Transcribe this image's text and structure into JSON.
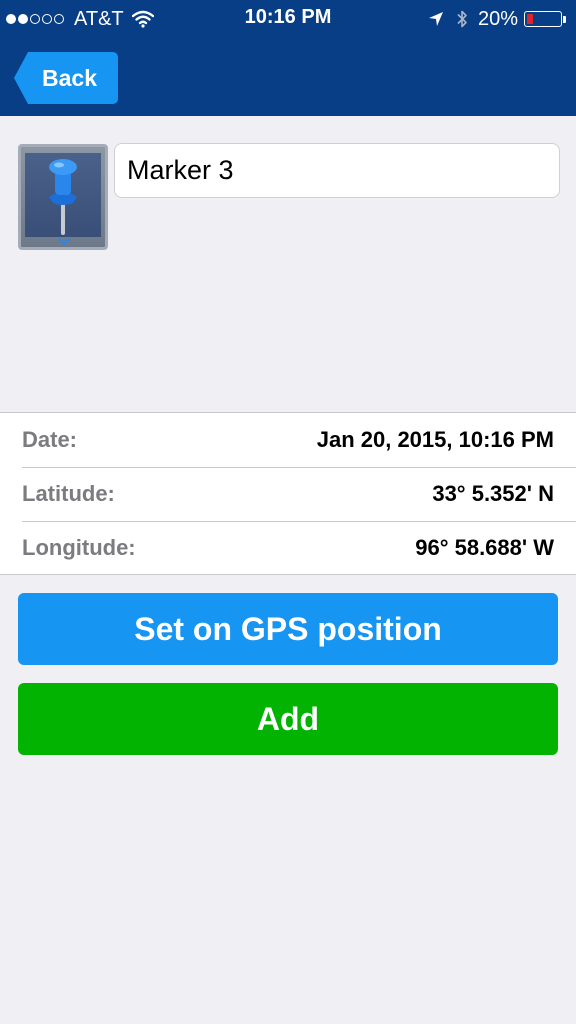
{
  "status_bar": {
    "carrier": "AT&T",
    "time": "10:16 PM",
    "battery_percent": "20%",
    "battery_level": 0.2,
    "signal_bars_filled": 2,
    "signal_bars_total": 5,
    "battery_color": "#e0242f"
  },
  "nav": {
    "back_label": "Back",
    "bar_color": "#083e85",
    "back_color": "#1695f3"
  },
  "marker": {
    "name": "Marker 3",
    "icon": "pushpin-icon"
  },
  "details": {
    "date_label": "Date:",
    "date_value": "Jan 20, 2015, 10:16 PM",
    "latitude_label": "Latitude:",
    "latitude_value": "33° 5.352' N",
    "longitude_label": "Longitude:",
    "longitude_value": "96° 58.688' W"
  },
  "actions": {
    "gps_label": "Set on GPS position",
    "gps_color": "#1695f3",
    "add_label": "Add",
    "add_color": "#02b302"
  }
}
